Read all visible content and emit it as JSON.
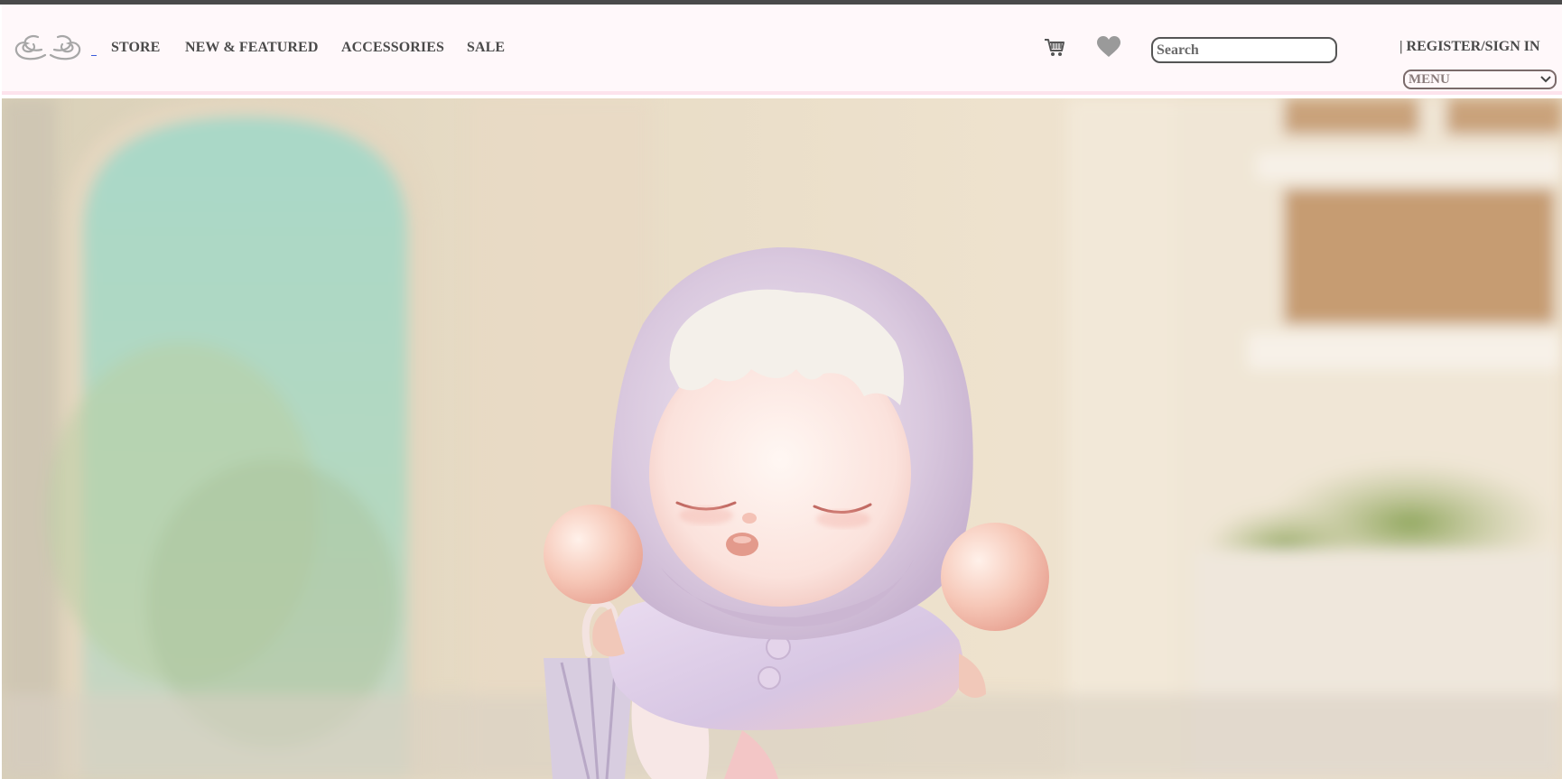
{
  "nav": {
    "links": [
      "STORE",
      "NEW & FEATURED",
      "ACCESSORIES",
      "SALE"
    ],
    "search_placeholder": "Search",
    "register_label": "| REGISTER/SIGN IN",
    "menu_label": "MENU"
  },
  "icons": {
    "logo": "wings-logo-icon",
    "cart": "shopping-cart-icon",
    "wishlist": "heart-icon",
    "menu_chevron": "chevron-down-icon"
  },
  "colors": {
    "nav_background": "#fff8fa",
    "nav_border": "#fde3ec",
    "nav_text": "#4a4a4a",
    "icon_grey": "#9a9a9a"
  }
}
